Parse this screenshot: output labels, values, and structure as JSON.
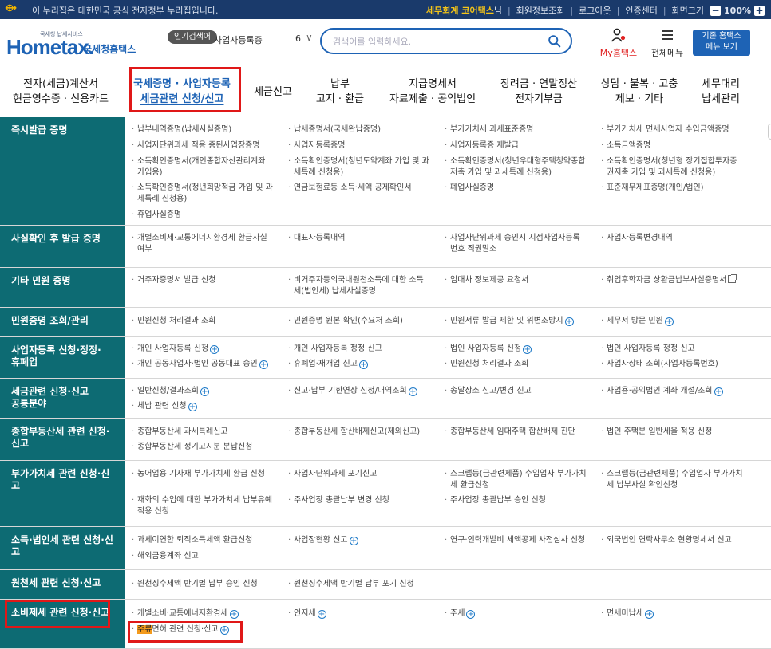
{
  "gov_bar": {
    "message": "이 누리집은 대한민국 공식 전자정부 누리집입니다.",
    "user_name": "세무회계 코어택스",
    "user_suffix": "님",
    "links": [
      "회원정보조회",
      "로그아웃",
      "인증센터",
      "화면크기"
    ],
    "zoom_minus": "−",
    "zoom": "100%",
    "zoom_plus": "+"
  },
  "header": {
    "logo_small": "국세청 납세서비스",
    "logo_text": "Hometax.",
    "logo_sub": "국세청홈택스",
    "popular_label": "인기검색어",
    "popular_term": "사업자등록증",
    "popular_num": "6",
    "popular_toggle": "∨",
    "search_placeholder": "검색어를 입력하세요.",
    "my_hometax_prefix": "My",
    "my_hometax_suffix": "홈택스",
    "full_menu": "전체메뉴",
    "classic_line1": "기존 홈택스",
    "classic_line2": "메뉴 보기"
  },
  "gnb": [
    {
      "line1": "전자(세금)계산서",
      "line2": "현금영수증 · 신용카드"
    },
    {
      "line1": "국세증명 · 사업자등록",
      "line2": "세금관련 신청/신고"
    },
    {
      "line1": "세금신고",
      "line2": ""
    },
    {
      "line1": "납부",
      "line2": "고지 · 환급"
    },
    {
      "line1": "지급명세서",
      "line2": "자료제출 · 공익법인"
    },
    {
      "line1": "장려금 · 연말정산",
      "line2": "전자기부금"
    },
    {
      "line1": "상담 · 불복 · 고충",
      "line2": "제보 · 기타"
    },
    {
      "line1": "세무대리",
      "line2": "납세관리"
    }
  ],
  "rows": [
    {
      "cat": [
        "즉시발급 증명"
      ],
      "items": [
        [
          "납부내역증명(납세사실증명)"
        ],
        [
          "납세증명서(국세완납증명)"
        ],
        [
          "부가가치세 과세표준증명"
        ],
        [
          "부가가치세 면세사업자 수입금액증명"
        ],
        [
          "사업자단위과세 적용 종된사업장증명"
        ],
        [
          "사업자등록증명"
        ],
        [
          "사업자등록증 재발급"
        ],
        [
          "소득금액증명"
        ],
        [
          "소득확인증명서(개인종합자산관리계좌",
          "가입용)"
        ],
        [
          "소득확인증명서(청년도약계좌 가입 및 과",
          "세특례 신청용)"
        ],
        [
          "소득확인증명서(청년우대형주택청약종합",
          "저축 가입 및 과세특례 신청용)"
        ],
        [
          "소득확인증명서(청년형 장기집합투자증",
          "권저축 가입 및 과세특례 신청용)"
        ],
        [
          "소득확인증명서(청년희망적금 가입 및 과",
          "세특례 신청용)"
        ],
        [
          "연금보험료등 소득·세액 공제확인서"
        ],
        [
          "폐업사실증명"
        ],
        [
          "표준재무제표증명(개인/법인)"
        ],
        [
          "휴업사실증명"
        ]
      ]
    },
    {
      "cat": [
        "사실확인 후 발급 증명"
      ],
      "items": [
        [
          "개별소비세·교통에너지환경세 환급사실",
          "여부"
        ],
        [
          "대표자등록내역"
        ],
        [
          "사업자단위과세 승인시 지점사업자등록",
          "번호 직권말소"
        ],
        [
          "사업자등록변경내역"
        ]
      ]
    },
    {
      "cat": [
        "기타 민원 증명"
      ],
      "items": [
        [
          "거주자증명서 발급 신청"
        ],
        [
          "비거주자등의국내원천소득에 대한 소득",
          "세(법인세) 납세사실증명"
        ],
        [
          "임대차 정보제공 요청서"
        ],
        [
          "취업후학자금 상환금납부사실증명서"
        ]
      ]
    },
    {
      "cat": [
        "민원증명 조회/관리"
      ],
      "items": [
        [
          "민원신청 처리결과 조회"
        ],
        [
          "민원증명 원본 확인(수요처 조회)"
        ],
        [
          "민원서류 발급 제한 및 위변조방지"
        ],
        [
          "세무서 방문 민원"
        ]
      ]
    },
    {
      "cat": [
        "사업자등록 신청·정정·",
        "휴폐업"
      ],
      "items": [
        [
          "개인 사업자등록 신청"
        ],
        [
          "개인 사업자등록 정정 신고"
        ],
        [
          "법인 사업자등록 신청"
        ],
        [
          "법인 사업자등록 정정 신고"
        ],
        [
          "개인 공동사업자·법인 공동대표 승인"
        ],
        [
          "휴폐업·재개업 신고"
        ],
        [
          "민원신청 처리결과 조회"
        ],
        [
          "사업자상태 조회(사업자등록번호)"
        ]
      ]
    },
    {
      "cat": [
        "세금관련 신청·신고",
        "공통분야"
      ],
      "items": [
        [
          "일반신청/결과조회"
        ],
        [
          "신고·납부 기한연장 신청/내역조회"
        ],
        [
          "송달장소 신고/변경 신고"
        ],
        [
          "사업용·공익법인 계좌 개설/조회"
        ],
        [
          "체납 관련 신청"
        ]
      ]
    },
    {
      "cat": [
        "종합부동산세 관련 신청·",
        "신고"
      ],
      "items": [
        [
          "종합부동산세 과세특례신고"
        ],
        [
          "종합부동산세 합산배제신고(제외신고)"
        ],
        [
          "종합부동산세 임대주택 합산배제 진단"
        ],
        [
          "법인 주택분 일반세율 적용 신청"
        ],
        [
          "종합부동산세 정기고지분 분납신청"
        ]
      ]
    },
    {
      "cat": [
        "부가가치세 관련 신청·신고"
      ],
      "items": [
        [
          "농어업용 기자재 부가가치세 환급 신청"
        ],
        [
          "사업자단위과세 포기신고"
        ],
        [
          "스크랩등(금관련제품) 수입업자 부가가치",
          "세 환급신청"
        ],
        [
          "스크랩등(금관련제품) 수입업자 부가가치",
          "세 납부사실 확인신청"
        ],
        [
          "재화의 수입에 대한 부가가치세 납부유예",
          "적용 신청"
        ],
        [
          "주사업장 총괄납부 변경 신청"
        ],
        [
          "주사업장 총괄납부 승인 신청"
        ]
      ]
    },
    {
      "cat": [
        "소득·법인세 관련 신청·신고"
      ],
      "items": [
        [
          "과세이연한 퇴직소득세액 환급신청"
        ],
        [
          "사업장현황 신고"
        ],
        [
          "연구·인력개발비 세액공제 사전심사 신청"
        ],
        [
          "외국법인 연락사무소 현황명세서 신고"
        ],
        [
          "해외금융계좌 신고"
        ]
      ]
    },
    {
      "cat": [
        "원천세 관련 신청·신고"
      ],
      "items": [
        [
          "원천징수세액 반기별 납부 승인 신청"
        ],
        [
          "원천징수세액 반기별 납부 포기 신청"
        ]
      ]
    },
    {
      "cat": [
        "소비제세 관련 신청·신고"
      ],
      "items": [
        [
          "개별소비·교통에너지환경세"
        ],
        [
          "인지세"
        ],
        [
          "주세"
        ],
        [
          "면세미납세"
        ],
        [
          "주류면허 관련 신청·신고"
        ]
      ]
    }
  ]
}
